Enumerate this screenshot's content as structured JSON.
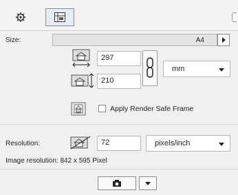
{
  "toolbar": {
    "tabs": [
      {
        "icon": "gear-icon"
      },
      {
        "icon": "layout-icon"
      }
    ]
  },
  "size": {
    "label": "Size:",
    "value": "A4"
  },
  "dimensions": {
    "width": "297",
    "height": "210",
    "unit": "mm"
  },
  "render": {
    "checkbox_label": "Apply Render Safe Frame",
    "checked": false
  },
  "resolution": {
    "label": "Resolution:",
    "value": "72",
    "unit": "pixels/inch"
  },
  "image_resolution": {
    "text": "Image resolution: 842 x 595 Pixel"
  },
  "bottom": {
    "camera_icon": "camera-icon"
  }
}
